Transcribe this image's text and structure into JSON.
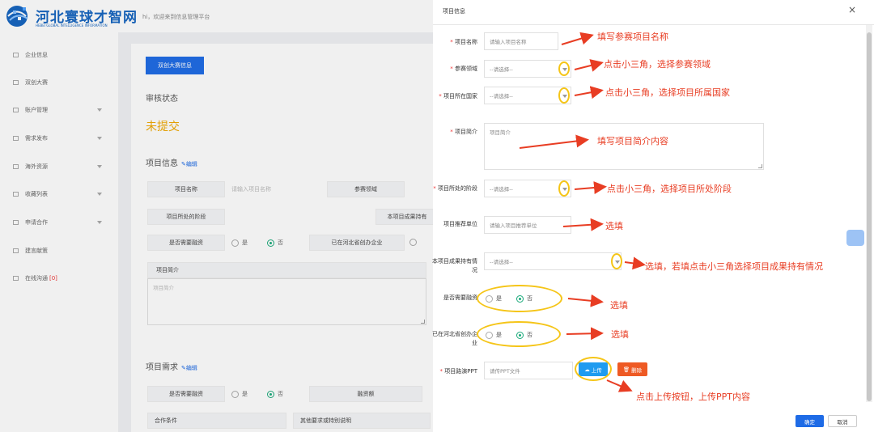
{
  "app": {
    "logo_title": "河北寰球才智网",
    "logo_subtitle": "HEBEI GLOBAL INTELLIGENCE INFORMATION",
    "welcome": "hi，欢迎来到信息管理平台"
  },
  "sidebar": {
    "items": [
      {
        "label": "企业信息"
      },
      {
        "label": "双创大赛"
      },
      {
        "label": "账户管理"
      },
      {
        "label": "需求发布"
      },
      {
        "label": "海外资源"
      },
      {
        "label": "收藏列表"
      },
      {
        "label": "申请合作"
      },
      {
        "label": "建言献策"
      },
      {
        "label": "在线沟通",
        "badge": "[0]"
      }
    ]
  },
  "background": {
    "tab_label": "双创大赛信息",
    "review_title": "审核状态",
    "review_status": "未提交",
    "project_info_title": "项目信息",
    "edit_label": "编辑",
    "fields": {
      "name": "项目名称",
      "name_placeholder": "请输入项目名称",
      "domain": "参赛领域",
      "stage": "项目所处的阶段",
      "ownership": "本项目成果持有",
      "financing": "是否需要融资",
      "yes": "是",
      "no": "否",
      "incubator": "已在河北省创办企业",
      "intro": "项目简介",
      "intro_placeholder": "项目简介"
    },
    "needs_title": "项目需求",
    "needs": {
      "financing": "是否需要融资",
      "amount": "融资额",
      "coop": "合作条件",
      "other": "其他要求或特别说明"
    }
  },
  "dialog": {
    "title": "项目信息",
    "close": "×",
    "rows": {
      "name_label": "项目名称",
      "name_placeholder": "请输入项目名称",
      "domain_label": "参赛领域",
      "select_placeholder": "--请选择--",
      "country_label": "项目所在国家",
      "intro_label": "项目简介",
      "intro_placeholder": "项目简介",
      "stage_label": "项目所处的阶段",
      "recommend_label": "项目推荐单位",
      "recommend_placeholder": "请输入项目推荐单位",
      "ownership_label": "本项目成果持有情况",
      "financing_label": "是否需要融资",
      "incubator_label": "已在河北省创办企业",
      "yes": "是",
      "no": "否",
      "ppt_label": "项目路演PPT",
      "ppt_placeholder": "请传PPT文件",
      "upload": "上传",
      "delete": "删除"
    },
    "ok": "确定",
    "cancel": "取消"
  },
  "annotations": {
    "name": "填写参赛项目名称",
    "domain": "点击小三角，选择参赛领域",
    "country": "点击小三角，选择项目所属国家",
    "intro": "填写项目简介内容",
    "stage": "点击小三角，选择项目所处阶段",
    "recommend": "选填",
    "ownership": "选填，若填点击小三角选择项目成果持有情况",
    "financing": "选填",
    "incubator": "选填",
    "upload": "点击上传按钮，上传PPT内容"
  }
}
